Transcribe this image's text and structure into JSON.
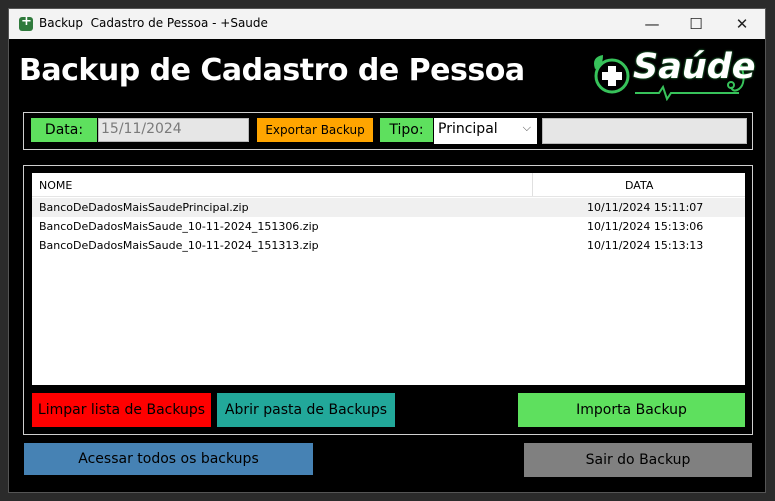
{
  "window": {
    "title": "Backup  Cadastro de Pessoa - +Saude",
    "minimize_glyph": "—",
    "maximize_glyph": "☐",
    "close_glyph": "✕"
  },
  "header": {
    "title": "Backup de Cadastro de Pessoa",
    "logo_text": "Saúde"
  },
  "toolbar": {
    "date_label": "Data:",
    "date_value": "15/11/2024",
    "export_label": "Exportar Backup",
    "type_label": "Tipo:",
    "type_value": "Principal",
    "extra_field_value": ""
  },
  "table": {
    "columns": [
      "NOME",
      "DATA"
    ],
    "rows": [
      {
        "name": "BancoDeDadosMaisSaudePrincipal.zip",
        "date": "10/11/2024 15:11:07",
        "selected": true
      },
      {
        "name": "BancoDeDadosMaisSaude_10-11-2024_151306.zip",
        "date": "10/11/2024 15:13:06",
        "selected": false
      },
      {
        "name": "BancoDeDadosMaisSaude_10-11-2024_151313.zip",
        "date": "10/11/2024 15:13:13",
        "selected": false
      }
    ]
  },
  "actions": {
    "clear_label": "Limpar lista de Backups",
    "open_folder_label": "Abrir pasta de Backups",
    "import_label": "Importa Backup"
  },
  "footer": {
    "all_backups_label": "Acessar todos os backups",
    "exit_label": "Sair do Backup"
  },
  "colors": {
    "green": "#5ee05e",
    "orange": "#ffa500",
    "red": "#ff0000",
    "teal": "#22a89a",
    "blue": "#4682b4",
    "gray": "#808080",
    "logo_green": "#37c25a"
  }
}
